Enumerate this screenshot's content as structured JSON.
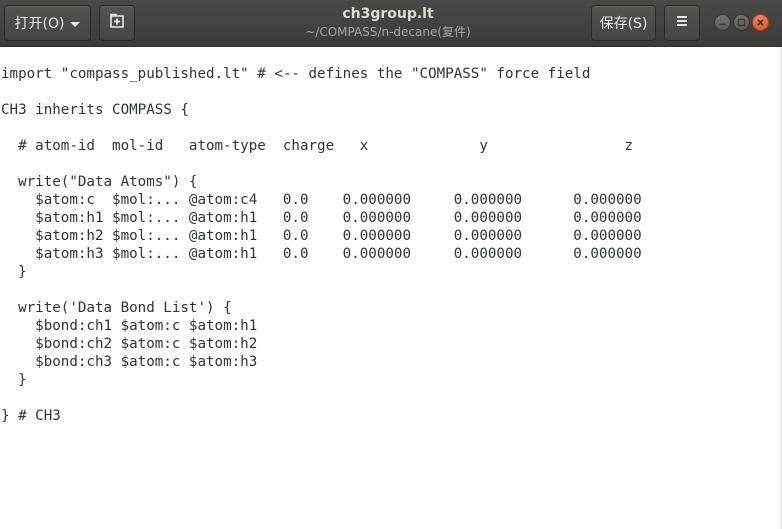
{
  "window": {
    "title": "ch3group.lt",
    "subtitle": "~/COMPASS/n-decane(复件)"
  },
  "toolbar": {
    "open_label": "打开(O)",
    "save_label": "保存(S)",
    "new_tab_icon": "new-document-icon",
    "menu_icon": "hamburger-menu-icon"
  },
  "window_controls": {
    "minimize_icon": "minimize-icon",
    "maximize_icon": "maximize-icon",
    "close_icon": "close-icon",
    "close_color": "#e95420"
  },
  "editor": {
    "lines": [
      "import \"compass_published.lt\" # <-- defines the \"COMPASS\" force field",
      "",
      "CH3 inherits COMPASS {",
      "",
      "  # atom-id  mol-id   atom-type  charge   x             y                z",
      "",
      "  write(\"Data Atoms\") {",
      "    $atom:c  $mol:... @atom:c4   0.0    0.000000     0.000000      0.000000",
      "    $atom:h1 $mol:... @atom:h1   0.0    0.000000     0.000000      0.000000",
      "    $atom:h2 $mol:... @atom:h1   0.0    0.000000     0.000000      0.000000",
      "    $atom:h3 $mol:... @atom:h1   0.0    0.000000     0.000000      0.000000",
      "  }",
      "",
      "  write('Data Bond List') {",
      "    $bond:ch1 $atom:c $atom:h1",
      "    $bond:ch2 $atom:c $atom:h2",
      "    $bond:ch3 $atom:c $atom:h3",
      "  }",
      "",
      "} # CH3"
    ]
  }
}
